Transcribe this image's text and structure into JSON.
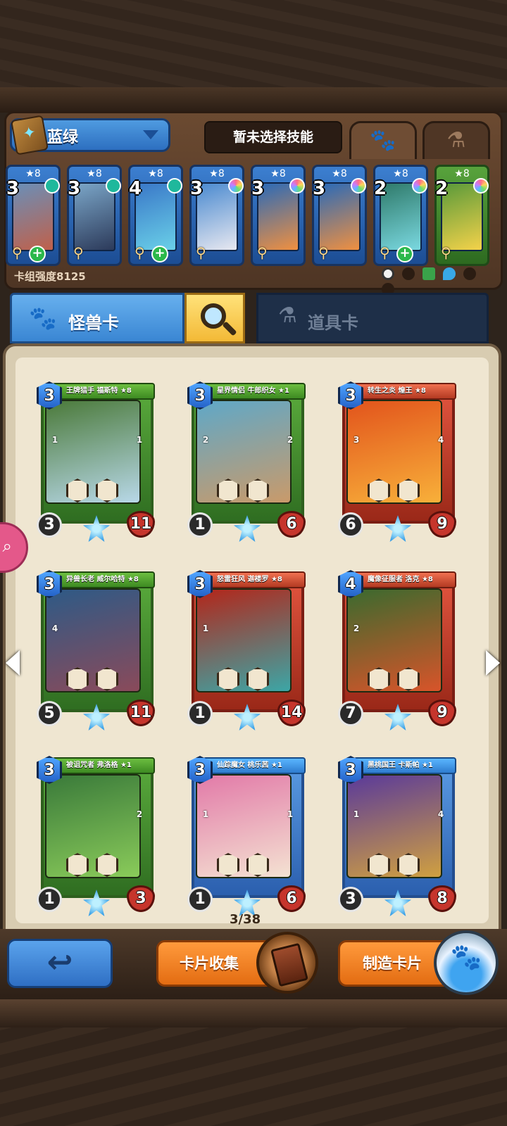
{
  "deck": {
    "name": "蓝绿",
    "skill_label": "暂未选择技能",
    "strength_label": "卡组强度8125",
    "cards": [
      {
        "star": "★8",
        "cost": "3",
        "rarity": "blue",
        "plus": true,
        "gem": "teal"
      },
      {
        "star": "★8",
        "cost": "3",
        "rarity": "blue",
        "plus": false,
        "gem": "teal"
      },
      {
        "star": "★8",
        "cost": "4",
        "rarity": "blue",
        "plus": true,
        "gem": "teal"
      },
      {
        "star": "★8",
        "cost": "3",
        "rarity": "blue",
        "plus": false,
        "gem": "rainbow"
      },
      {
        "star": "★8",
        "cost": "3",
        "rarity": "blue",
        "plus": false,
        "gem": "rainbow"
      },
      {
        "star": "★8",
        "cost": "3",
        "rarity": "blue",
        "plus": false,
        "gem": "rainbow"
      },
      {
        "star": "★8",
        "cost": "2",
        "rarity": "blue",
        "plus": true,
        "gem": "rainbow"
      },
      {
        "star": "★8",
        "cost": "2",
        "rarity": "green",
        "plus": false,
        "gem": "rainbow"
      }
    ]
  },
  "tabs": {
    "monster_label": "怪兽卡",
    "item_label": "道具卡"
  },
  "cards": [
    {
      "title": "王牌猎手 福斯特 ★8",
      "cost": "3",
      "atk": "3",
      "hp": "11",
      "rarity": "green",
      "pip_left": "1",
      "pip_right": "1",
      "skill_val": "1",
      "art": [
        "#4b7a3a",
        "#b8d8e8"
      ]
    },
    {
      "title": "星界情侣 牛郎织女 ★1",
      "cost": "3",
      "atk": "1",
      "hp": "6",
      "rarity": "green",
      "pip_left": "2",
      "pip_right": "2",
      "skill_val": "1",
      "art": [
        "#5fa8c8",
        "#c99a6a"
      ]
    },
    {
      "title": "转生之炎 煌王 ★8",
      "cost": "3",
      "atk": "6",
      "hp": "9",
      "rarity": "red",
      "pip_left": "3",
      "pip_right": "4",
      "skill_val": "",
      "art": [
        "#e2541c",
        "#f8b03a"
      ]
    },
    {
      "title": "异兽长老 威尔哈特 ★8",
      "cost": "3",
      "atk": "5",
      "hp": "11",
      "rarity": "green",
      "pip_left": "4",
      "pip_right": "",
      "skill_val": "4",
      "art": [
        "#2e5a86",
        "#8a4a5a"
      ]
    },
    {
      "title": "怒雷狂风 迦楼罗 ★8",
      "cost": "3",
      "atk": "1",
      "hp": "14",
      "rarity": "red",
      "pip_left": "1",
      "pip_right": "",
      "skill_val": "",
      "art": [
        "#b3261a",
        "#3ca6a6"
      ]
    },
    {
      "title": "魔像征服者 洛克 ★8",
      "cost": "4",
      "atk": "7",
      "hp": "9",
      "rarity": "red",
      "pip_left": "2",
      "pip_right": "",
      "skill_val": "",
      "art": [
        "#3b6a2e",
        "#d8542a"
      ]
    },
    {
      "title": "被诅咒者 弗洛格 ★1",
      "cost": "3",
      "atk": "1",
      "hp": "3",
      "rarity": "green",
      "pip_left": "",
      "pip_right": "2",
      "skill_val": "",
      "art": [
        "#3a7a3a",
        "#8acb5a"
      ]
    },
    {
      "title": "仙踪魔女 桃乐茜 ★1",
      "cost": "3",
      "atk": "1",
      "hp": "6",
      "rarity": "blue",
      "pip_left": "1",
      "pip_right": "1",
      "skill_val": "2",
      "art": [
        "#e27aa8",
        "#f4e2d2"
      ]
    },
    {
      "title": "黑桃国王 卡斯帕 ★1",
      "cost": "3",
      "atk": "3",
      "hp": "8",
      "rarity": "blue",
      "pip_left": "1",
      "pip_right": "4",
      "skill_val": "2",
      "art": [
        "#5a3a9a",
        "#d0a040"
      ]
    }
  ],
  "page_count": "3/38",
  "buttons": {
    "collect_label": "卡片收集",
    "craft_label": "制造卡片"
  },
  "colors": {
    "blue_accent": "#3a86d3",
    "orange_button": "#e36c12",
    "search_yellow": "#f3b936"
  }
}
